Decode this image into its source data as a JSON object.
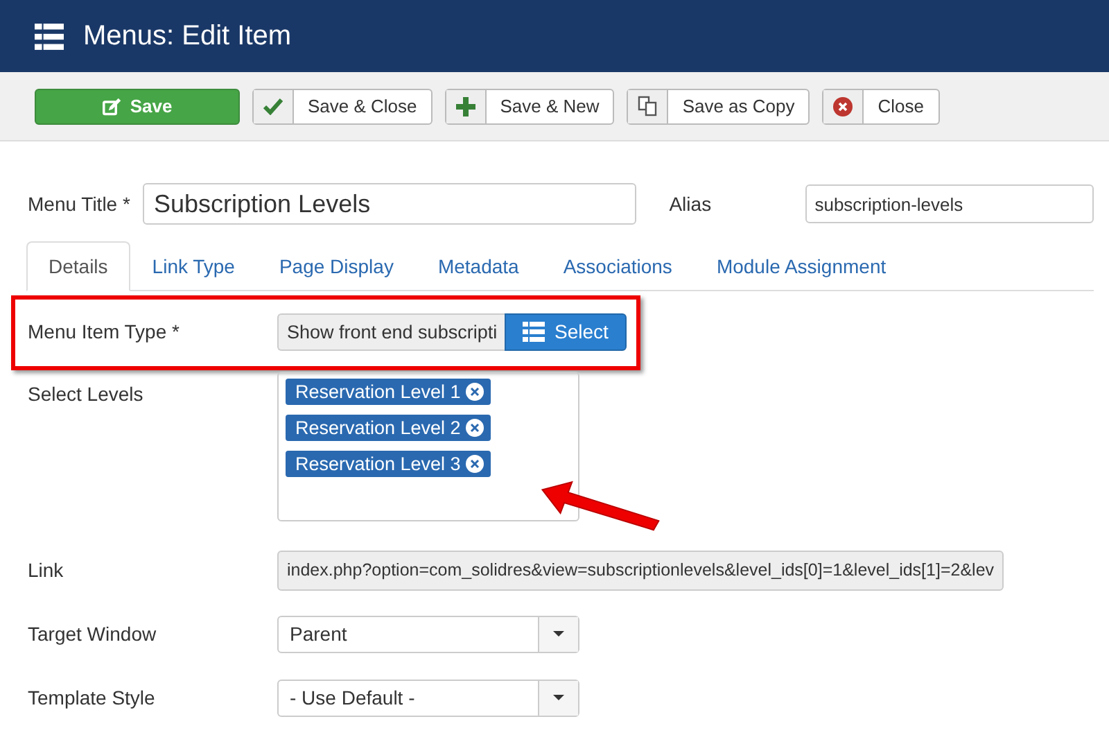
{
  "header": {
    "title": "Menus: Edit Item"
  },
  "toolbar": [
    {
      "label": "Save",
      "kind": "success"
    },
    {
      "label": "Save & Close",
      "kind": "default"
    },
    {
      "label": "Save & New",
      "kind": "default"
    },
    {
      "label": "Save as Copy",
      "kind": "default"
    },
    {
      "label": "Close",
      "kind": "default"
    }
  ],
  "menu_title": {
    "label": "Menu Title *",
    "value": "Subscription Levels"
  },
  "alias": {
    "label": "Alias",
    "value": "subscription-levels"
  },
  "tabs": [
    {
      "label": "Details",
      "selected": true
    },
    {
      "label": "Link Type",
      "selected": false
    },
    {
      "label": "Page Display",
      "selected": false
    },
    {
      "label": "Metadata",
      "selected": false
    },
    {
      "label": "Associations",
      "selected": false
    },
    {
      "label": "Module Assignment",
      "selected": false
    }
  ],
  "fields": [
    {
      "kind": "type",
      "label": "Menu Item Type *",
      "value": "Show front end subscripti",
      "button": "Select"
    },
    {
      "kind": "tags",
      "label": "Select Levels",
      "tags": [
        "Reservation Level 1",
        "Reservation Level 2",
        "Reservation Level 3"
      ]
    },
    {
      "kind": "readonly",
      "label": "Link",
      "value": "index.php?option=com_solidres&view=subscriptionlevels&level_ids[0]=1&level_ids[1]=2&lev"
    },
    {
      "kind": "select",
      "label": "Target Window",
      "value": "Parent"
    },
    {
      "kind": "select",
      "label": "Template Style",
      "value": "- Use Default -"
    }
  ]
}
